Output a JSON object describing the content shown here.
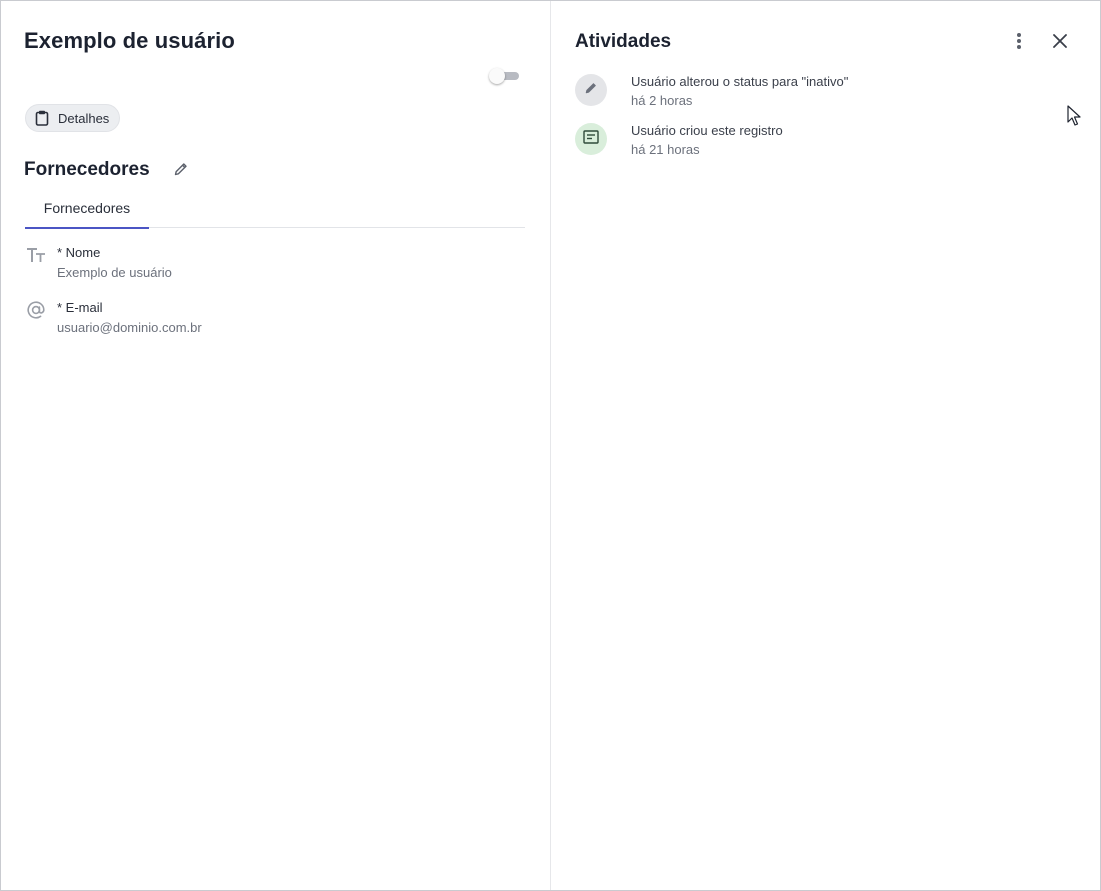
{
  "record": {
    "title": "Exemplo de usuário",
    "chip_label": "Detalhes",
    "toggle_on": false
  },
  "section": {
    "title": "Fornecedores",
    "tabs": [
      {
        "label": "Fornecedores",
        "active": true
      }
    ],
    "fields": [
      {
        "icon": "text-type-icon",
        "label": "* Nome",
        "value": "Exemplo de usuário"
      },
      {
        "icon": "at-sign-icon",
        "label": "* E-mail",
        "value": "usuario@dominio.com.br"
      }
    ]
  },
  "activities": {
    "title": "Atividades",
    "items": [
      {
        "icon": "pencil-icon",
        "text": "Usuário alterou o status para \"inativo\"",
        "time": "há 2 horas",
        "avatar_color": "#e4e5e8"
      },
      {
        "icon": "note-icon",
        "text": "Usuário criou este registro",
        "time": "há 21 horas",
        "avatar_color": "#d9eedb"
      }
    ]
  },
  "colors": {
    "accent": "#4b55c4",
    "text_primary": "#1c2230",
    "text_secondary": "#6c717c"
  }
}
